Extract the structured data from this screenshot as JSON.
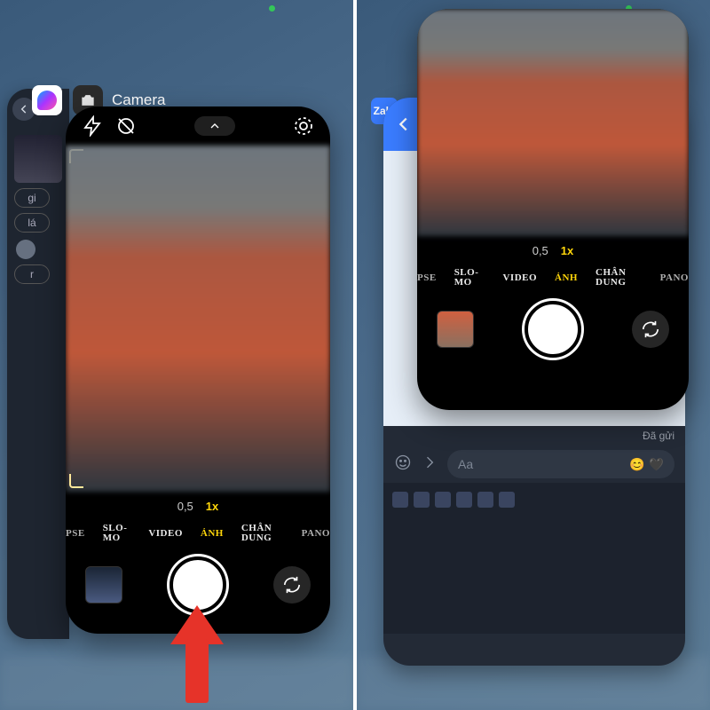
{
  "switcher": {
    "app_label": "Camera",
    "zalo_label": "Zalo"
  },
  "camera": {
    "zoom": {
      "wide": "0,5",
      "main": "1x"
    },
    "modes": {
      "edge_left": "PSE",
      "slomo": "SLO-MO",
      "video": "VIDEO",
      "photo": "ẢNH",
      "portrait": "CHÂN DUNG",
      "pano": "PANO"
    }
  },
  "chat": {
    "sent_label": "Đã gửi",
    "placeholder": "Aa",
    "behind_items": [
      "gi",
      "lá",
      "r"
    ]
  }
}
